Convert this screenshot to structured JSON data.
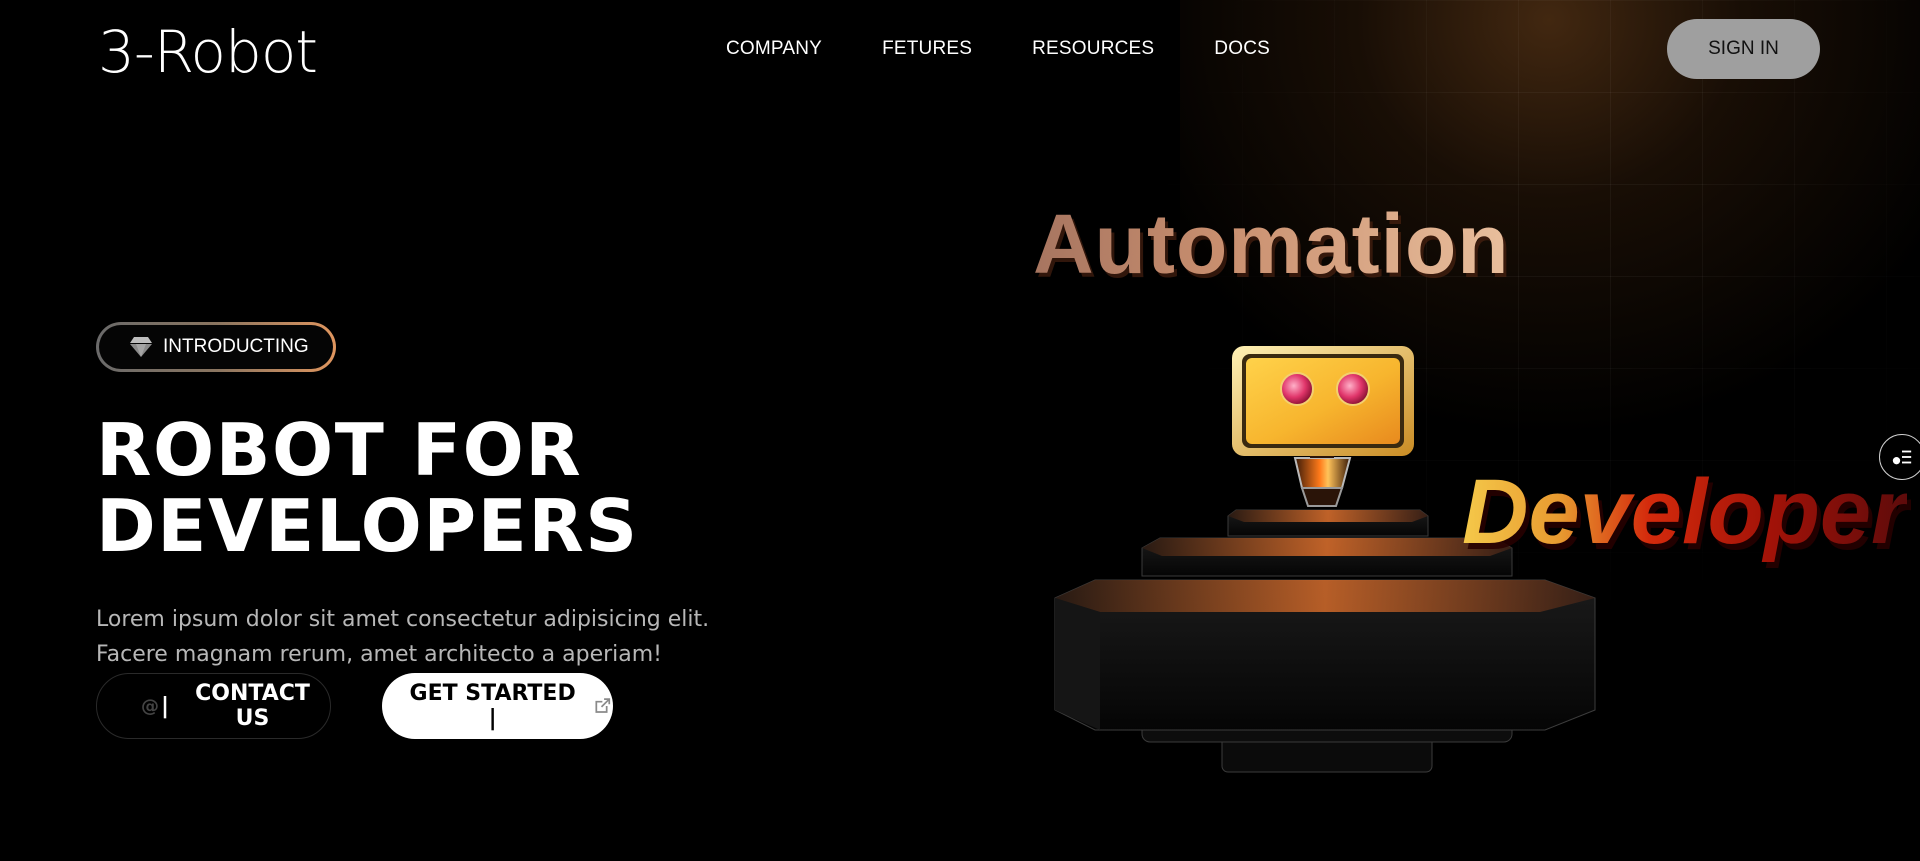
{
  "header": {
    "logo": "3-Robot",
    "nav": [
      "COMPANY",
      "FETURES",
      "RESOURCES",
      "DOCS"
    ],
    "sign_in": "SIGN IN"
  },
  "hero": {
    "badge": {
      "icon": "diamond-icon",
      "label": "INTRODUCTING"
    },
    "title_line1": "ROBOT FOR",
    "title_line2": "DEVELOPERS",
    "description_line1": "Lorem ipsum dolor sit amet consectetur adipisicing elit.",
    "description_line2": "Facere magnam rerum, amet architecto a aperiam!",
    "contact_button": {
      "prefix": "@",
      "caret": "|",
      "label": "CONTACT US"
    },
    "start_button": {
      "label": "GET STARTED |",
      "icon": "external-link-icon"
    }
  },
  "scene": {
    "word_top": "Automation",
    "word_right": "Developer",
    "robot_icon": "robot-illustration"
  },
  "side_button_icon": "menu-list-icon",
  "colors": {
    "background": "#000000",
    "signin_bg": "#9f9f9f",
    "badge_gradient_end": "#e0965f",
    "accent_orange": "#d86a2a",
    "robot_head": "#f5c23a"
  }
}
